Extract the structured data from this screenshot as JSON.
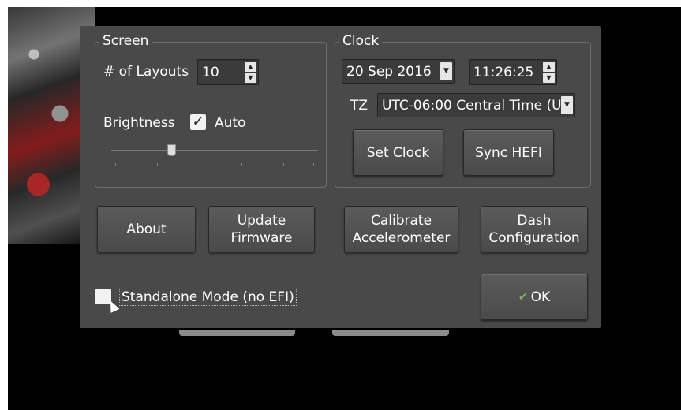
{
  "screen": {
    "title": "Screen",
    "layouts_label": "# of Layouts",
    "layouts_value": "10",
    "brightness_label": "Brightness",
    "auto_label": "Auto",
    "auto_checked": true,
    "brightness_level_fraction": 0.29
  },
  "clock": {
    "title": "Clock",
    "date_value": "20 Sep 2016",
    "time_value": "11:26:25",
    "tz_label": "TZ",
    "tz_value": "UTC-06:00 Central Time (U",
    "set_clock_label": "Set Clock",
    "sync_label": "Sync HEFI"
  },
  "actions": {
    "about": "About",
    "update_line1": "Update",
    "update_line2": "Firmware",
    "calibrate_line1": "Calibrate",
    "calibrate_line2": "Accelerometer",
    "dash_line1": "Dash",
    "dash_line2": "Configuration"
  },
  "standalone": {
    "label": "Standalone Mode (no EFI)",
    "checked": false
  },
  "ok_label": "OK",
  "colors": {
    "dialog_bg": "#494949",
    "ok_icon": "#7ab55c"
  }
}
